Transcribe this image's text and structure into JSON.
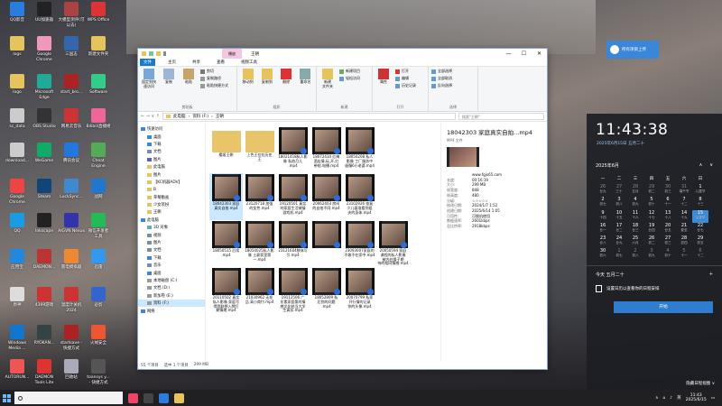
{
  "desktop": {
    "icons": [
      {
        "label": "QQ影音",
        "color": "#2a7de0"
      },
      {
        "label": "UU加速器",
        "color": "#222"
      },
      {
        "label": "大模型测评(可\n以去)",
        "color": "#a44"
      },
      {
        "label": "WPS Office",
        "color": "#d33"
      },
      {
        "label": "logs",
        "color": "#e6c35c"
      },
      {
        "label": "Google\nChrome",
        "color": "#e9b"
      },
      {
        "label": "三国志",
        "color": "#36a"
      },
      {
        "label": "新建文件夹",
        "color": "#e6c35c"
      },
      {
        "label": "logo",
        "color": "#e6c35c"
      },
      {
        "label": "Microsoft\nEdge",
        "color": "#2a9"
      },
      {
        "label": "start_bro...",
        "color": "#a22"
      },
      {
        "label": "Software",
        "color": "#3c8"
      },
      {
        "label": "sc_data",
        "color": "#ccc"
      },
      {
        "label": "OBS Studio",
        "color": "#333"
      },
      {
        "label": "网易云音乐",
        "color": "#c33"
      },
      {
        "label": "Bilibili直播姬",
        "color": "#e69"
      },
      {
        "label": "download...",
        "color": "#ccc"
      },
      {
        "label": "WeGame",
        "color": "#1a6"
      },
      {
        "label": "腾讯会议",
        "color": "#27d"
      },
      {
        "label": "Cheat Engine",
        "color": "#5a5"
      },
      {
        "label": "Google\nChrome",
        "color": "#e44"
      },
      {
        "label": "Steam",
        "color": "#147"
      },
      {
        "label": "LuckSync...",
        "color": "#48c"
      },
      {
        "label": "战网",
        "color": "#27c"
      },
      {
        "label": "QQ",
        "color": "#1a9be6"
      },
      {
        "label": "Inkscape",
        "color": "#222"
      },
      {
        "label": "AIGVN Nexus",
        "color": "#33a"
      },
      {
        "label": "微信开发者\n工具",
        "color": "#2b5"
      },
      {
        "label": "应用宝",
        "color": "#28d"
      },
      {
        "label": "DAEMON...",
        "color": "#b33"
      },
      {
        "label": "雷电模拟器",
        "color": "#e83"
      },
      {
        "label": "迅雷",
        "color": "#39e"
      },
      {
        "label": "原神",
        "color": "#ddd"
      },
      {
        "label": "4399游戏",
        "color": "#c33"
      },
      {
        "label": "温度计关机\n2024",
        "color": "#c33"
      },
      {
        "label": "必剪",
        "color": "#36c"
      },
      {
        "label": "Windows\nMedia ...",
        "color": "#17c"
      },
      {
        "label": "RYOKAN...",
        "color": "#344"
      },
      {
        "label": "startsave -\n快捷方式",
        "color": "#a22"
      },
      {
        "label": "火绒安全",
        "color": "#e53"
      },
      {
        "label": "AUTORUN...",
        "color": "#e55"
      },
      {
        "label": "DAEMON\nTools Lite",
        "color": "#d33"
      },
      {
        "label": "回收站",
        "color": "#aab"
      },
      {
        "label": "toansys y...\n- 快捷方式",
        "color": "#555"
      },
      {
        "label": "Whatease -\n快捷方式",
        "color": "#bbb"
      }
    ]
  },
  "upload_button": {
    "label": "所有项目上传"
  },
  "explorer": {
    "manage_tab": "播放",
    "title": "王朝",
    "window_controls": [
      "—",
      "☐",
      "✕"
    ],
    "tabs": [
      "文件",
      "主页",
      "共享",
      "查看",
      "视频工具"
    ],
    "ribbon": {
      "clipboard": {
        "pin": "固定到快\n速访问",
        "copy": "复制",
        "paste": "粘贴",
        "cut": "剪切",
        "copy_path": "复制路径",
        "paste_shortcut": "粘贴快捷方式",
        "group": "剪贴板"
      },
      "organize": {
        "move": "移动到",
        "copyto": "复制到",
        "delete": "删除",
        "rename": "重命名",
        "group": "组织"
      },
      "new": {
        "folder": "新建\n文件夹",
        "item": "新建项目",
        "easy": "轻松访问",
        "group": "新建"
      },
      "open": {
        "props": "属性",
        "open": "打开",
        "edit": "编辑",
        "history": "历史记录",
        "group": "打开"
      },
      "select": {
        "all": "全部选择",
        "none": "全部取消",
        "invert": "反向选择",
        "group": "选择"
      }
    },
    "address": {
      "nav": "←  →  ∨  ↑",
      "path": [
        "此电脑",
        "资料 (F:)",
        "王朝"
      ],
      "search_placeholder": "搜索\"王朝\""
    },
    "nav_items": [
      {
        "label": "快速访问",
        "lvl": 0,
        "color": "#3a86d8"
      },
      {
        "label": "桌面",
        "lvl": 1,
        "color": "#3a86d8"
      },
      {
        "label": "下载",
        "lvl": 1,
        "color": "#3a86d8"
      },
      {
        "label": "文档",
        "lvl": 1,
        "color": "#7a8da6"
      },
      {
        "label": "图片",
        "lvl": 1,
        "color": "#56a"
      },
      {
        "label": "此电脑",
        "lvl": 1,
        "color": "#e6c35c"
      },
      {
        "label": "图片",
        "lvl": 1,
        "color": "#e6c35c"
      },
      {
        "label": "【KC机器ADV】",
        "lvl": 1,
        "color": "#e6c35c"
      },
      {
        "label": "B",
        "lvl": 1,
        "color": "#e6c35c"
      },
      {
        "label": "草莓動画",
        "lvl": 1,
        "color": "#e6c35c"
      },
      {
        "label": "少女装扮",
        "lvl": 1,
        "color": "#e6c35c"
      },
      {
        "label": "王朝",
        "lvl": 1,
        "color": "#e6c35c"
      },
      {
        "label": "此电脑",
        "lvl": 0,
        "color": "#3a86d8"
      },
      {
        "label": "3D 对象",
        "lvl": 1,
        "color": "#6ab"
      },
      {
        "label": "视频",
        "lvl": 1,
        "color": "#7a8da6"
      },
      {
        "label": "图片",
        "lvl": 1,
        "color": "#7a8da6"
      },
      {
        "label": "文档",
        "lvl": 1,
        "color": "#7a8da6"
      },
      {
        "label": "下载",
        "lvl": 1,
        "color": "#3a86d8"
      },
      {
        "label": "音乐",
        "lvl": 1,
        "color": "#7a8da6"
      },
      {
        "label": "桌面",
        "lvl": 1,
        "color": "#3a86d8"
      },
      {
        "label": "本地磁盘 (C:)",
        "lvl": 1,
        "color": "#999"
      },
      {
        "label": "文档 (D:)",
        "lvl": 1,
        "color": "#999"
      },
      {
        "label": "新加卷 (E:)",
        "lvl": 1,
        "color": "#999"
      },
      {
        "label": "资料 (F:)",
        "lvl": 1,
        "color": "#999",
        "selected": true
      },
      {
        "label": "网络",
        "lvl": 0,
        "color": "#3a86d8"
      }
    ],
    "files": [
      {
        "name": "樱坂王朝",
        "kind": "fold"
      },
      {
        "name": "上色王拉拉历史\n王",
        "kind": "fold"
      },
      {
        "name": "18021418私人影\n像 私拍月儿\n.mp4",
        "kind": "vid"
      },
      {
        "name": "18072434 红梅\n酒店情,玩,开,红\n带船.电播.mp4",
        "kind": "vid"
      },
      {
        "name": "18050208 私人\n影像 工厂服务中\n极慢6小老婆.mp4",
        "kind": "vid"
      },
      {
        "name": "",
        "kind": "none"
      },
      {
        "name": "",
        "kind": "none"
      },
      {
        "name": "18042303 家庭\n真实自拍.mp4",
        "kind": "vid",
        "selected": true
      },
      {
        "name": "23120718 加强\n的女性.mp4",
        "kind": "vid"
      },
      {
        "name": "19120501 真实\n的家庭生活城镇\n游戏机.mp4",
        "kind": "vid"
      },
      {
        "name": "20062403 房间\n的自拍不同.mp4",
        "kind": "vid"
      },
      {
        "name": "23102926 恢复\n少儿基准看到姐\n夫的身体.mp4",
        "kind": "vid"
      },
      {
        "name": "",
        "kind": "none"
      },
      {
        "name": "",
        "kind": "none"
      },
      {
        "name": "18050515 后续\n.mp4",
        "kind": "vid"
      },
      {
        "name": "18050025私人影\n像 土豪家里第\n一.mp4",
        "kind": "vid"
      },
      {
        "name": "23121604肢体写\n引.mp4",
        "kind": "vid"
      },
      {
        "name": "",
        "kind": "vid"
      },
      {
        "name": "23093007家庭的\n不敢不在家中.mp4",
        "kind": "vid"
      },
      {
        "name": "20050594 家庭\n课程的私人影像\n被内在隆子期\n待的相同情感.mp4",
        "kind": "vid"
      },
      {
        "name": "",
        "kind": "none"
      },
      {
        "name": "20110502 真实\n私人影像 家庭写\n得我联想入牌打\n剩情绪.mp4",
        "kind": "vid"
      },
      {
        "name": "21030962 无毛\n品 高小商忖.mp4",
        "kind": "vid"
      },
      {
        "name": "19112506 广\n东素家庭第的情\n感文化结当大学\n生真实.mp4",
        "kind": "vid"
      },
      {
        "name": "18052809 私\n后到的问题\n.mp4",
        "kind": "vid"
      },
      {
        "name": "20070799 私家\n开行情的记录\n你的头像.mp4",
        "kind": "vid"
      },
      {
        "name": "",
        "kind": "none"
      },
      {
        "name": "",
        "kind": "none"
      }
    ],
    "preview": {
      "title": "18042303 家庭真实自拍...mp4",
      "type": "MP4 文件",
      "rows": [
        {
          "k": "",
          "v": "www.fgjx65.com"
        },
        {
          "k": "长度:",
          "v": "00:16:19"
        },
        {
          "k": "大小:",
          "v": "299 MB"
        },
        {
          "k": "帧宽度:",
          "v": "848"
        },
        {
          "k": "帧高度:",
          "v": "480"
        },
        {
          "k": "分级:",
          "v": "☆☆☆☆☆"
        },
        {
          "k": "修改日期:",
          "v": "2024/1/7 1:52"
        },
        {
          "k": "创建日期:",
          "v": "2025/6/14 1:05"
        },
        {
          "k": "可用性:",
          "v": "可脱机使用"
        },
        {
          "k": "数据速率:",
          "v": "2601kbps"
        },
        {
          "k": "总比特率:",
          "v": "2918kbps"
        }
      ]
    },
    "status": {
      "count": "55 个项目",
      "selected": "选中 1 个项目",
      "size": "299 MB"
    }
  },
  "clock": {
    "time": "11:43:38",
    "date": "2025年6月15日 五月二十",
    "month": "2025年6月",
    "weekdays": [
      "一",
      "二",
      "三",
      "四",
      "五",
      "六",
      "日"
    ],
    "days": [
      {
        "d": "26",
        "l": "廿九",
        "dim": true
      },
      {
        "d": "27",
        "l": "三十",
        "dim": true
      },
      {
        "d": "28",
        "l": "五月",
        "dim": true
      },
      {
        "d": "29",
        "l": "初二",
        "dim": true
      },
      {
        "d": "30",
        "l": "初三",
        "dim": true
      },
      {
        "d": "31",
        "l": "端午节",
        "dim": true
      },
      {
        "d": "1",
        "l": "儿童节"
      },
      {
        "d": "2",
        "l": "初七"
      },
      {
        "d": "3",
        "l": "初八"
      },
      {
        "d": "4",
        "l": "初九"
      },
      {
        "d": "5",
        "l": "初十"
      },
      {
        "d": "6",
        "l": "十一"
      },
      {
        "d": "7",
        "l": "十二"
      },
      {
        "d": "8",
        "l": "十三"
      },
      {
        "d": "9",
        "l": "十四"
      },
      {
        "d": "10",
        "l": "十五"
      },
      {
        "d": "11",
        "l": "十六"
      },
      {
        "d": "12",
        "l": "十七"
      },
      {
        "d": "13",
        "l": "十八"
      },
      {
        "d": "14",
        "l": "十九"
      },
      {
        "d": "15",
        "l": "父亲节",
        "today": true
      },
      {
        "d": "16",
        "l": "廿一"
      },
      {
        "d": "17",
        "l": "廿二"
      },
      {
        "d": "18",
        "l": "廿三"
      },
      {
        "d": "19",
        "l": "廿四"
      },
      {
        "d": "20",
        "l": "廿五"
      },
      {
        "d": "21",
        "l": "夏至"
      },
      {
        "d": "22",
        "l": "廿七"
      },
      {
        "d": "23",
        "l": "廿八"
      },
      {
        "d": "24",
        "l": "廿九"
      },
      {
        "d": "25",
        "l": "六月"
      },
      {
        "d": "26",
        "l": "初二"
      },
      {
        "d": "27",
        "l": "初三"
      },
      {
        "d": "28",
        "l": "初四"
      },
      {
        "d": "29",
        "l": "初五"
      },
      {
        "d": "30",
        "l": "初六"
      },
      {
        "d": "1",
        "l": "初七",
        "dim": true
      },
      {
        "d": "2",
        "l": "初八",
        "dim": true
      },
      {
        "d": "3",
        "l": "初九",
        "dim": true
      },
      {
        "d": "4",
        "l": "初十",
        "dim": true
      },
      {
        "d": "5",
        "l": "十一",
        "dim": true
      },
      {
        "d": "6",
        "l": "十二",
        "dim": true
      }
    ],
    "events_title": "今天 五月二十",
    "event_text": "设置日历以查看你的日程安排",
    "event_button": "开始",
    "hide_schedule": "隐藏日程视图 ∨"
  },
  "taskbar": {
    "apps": [
      "#e46",
      "#444",
      "#2a7de0",
      "#e6c35c"
    ],
    "tray_lang": "英",
    "time": "11:43",
    "date": "2025/6/15"
  }
}
